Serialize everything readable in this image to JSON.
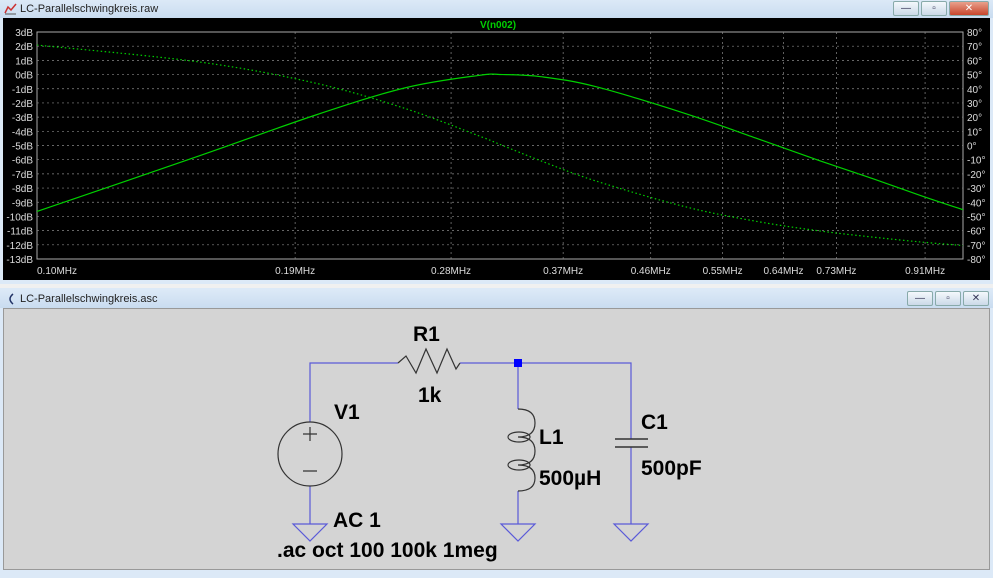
{
  "plot_window": {
    "title": "LC-Parallelschwingkreis.raw",
    "trace_label": "V(n002)",
    "buttons": [
      "minimize",
      "restore",
      "close"
    ]
  },
  "schematic_window": {
    "title": "LC-Parallelschwingkreis.asc",
    "buttons": [
      "minimize",
      "restore",
      "close"
    ]
  },
  "colors": {
    "trace": "#00d000",
    "wire": "#5a5ad8",
    "node": "#0000ff",
    "plot_bg": "#000000",
    "sch_bg": "#d4d4d4"
  },
  "chart_data": {
    "type": "line",
    "title": "V(n002)",
    "x_scale": "log",
    "xlim_mhz": [
      0.1,
      1.0
    ],
    "x_ticks": [
      "0.10MHz",
      "0.19MHz",
      "0.28MHz",
      "0.37MHz",
      "0.46MHz",
      "0.55MHz",
      "0.64MHz",
      "0.73MHz",
      "0.91MHz"
    ],
    "x_tick_values": [
      0.1,
      0.19,
      0.28,
      0.37,
      0.46,
      0.55,
      0.64,
      0.73,
      0.91
    ],
    "y_left_ticks": [
      "3dB",
      "2dB",
      "1dB",
      "0dB",
      "-1dB",
      "-2dB",
      "-3dB",
      "-4dB",
      "-5dB",
      "-6dB",
      "-7dB",
      "-8dB",
      "-9dB",
      "-10dB",
      "-11dB",
      "-12dB",
      "-13dB"
    ],
    "ylim_db": [
      -13,
      3
    ],
    "y_right_ticks": [
      "80°",
      "70°",
      "60°",
      "50°",
      "40°",
      "30°",
      "20°",
      "10°",
      "0°",
      "-10°",
      "-20°",
      "-30°",
      "-40°",
      "-50°",
      "-60°",
      "-70°",
      "-80°"
    ],
    "ylim_deg": [
      -80,
      80
    ],
    "grid": true,
    "x": [
      0.1,
      0.15,
      0.2,
      0.25,
      0.3,
      0.3183,
      0.35,
      0.4,
      0.5,
      0.6,
      0.7,
      0.8,
      0.9,
      1.0
    ],
    "series": [
      {
        "name": "magnitude_dB",
        "style": "solid",
        "values": [
          -9.65,
          -5.71,
          -2.85,
          -0.93,
          -0.06,
          0,
          -0.15,
          -0.83,
          -2.72,
          -4.52,
          -6.07,
          -7.35,
          -8.53,
          -9.53
        ]
      },
      {
        "name": "phase_deg",
        "style": "dotted",
        "values": [
          70.8,
          58.8,
          43.9,
          26.0,
          6.8,
          0,
          -10.8,
          -24.7,
          -43.0,
          -53.6,
          -60.2,
          -64.6,
          -68.0,
          -70.5
        ]
      }
    ]
  },
  "schematic": {
    "R1": {
      "name": "R1",
      "value": "1k"
    },
    "V1": {
      "name": "V1",
      "value": "AC 1"
    },
    "L1": {
      "name": "L1",
      "value": "500µH"
    },
    "C1": {
      "name": "C1",
      "value": "500pF"
    },
    "directive": ".ac oct 100 100k 1meg"
  }
}
